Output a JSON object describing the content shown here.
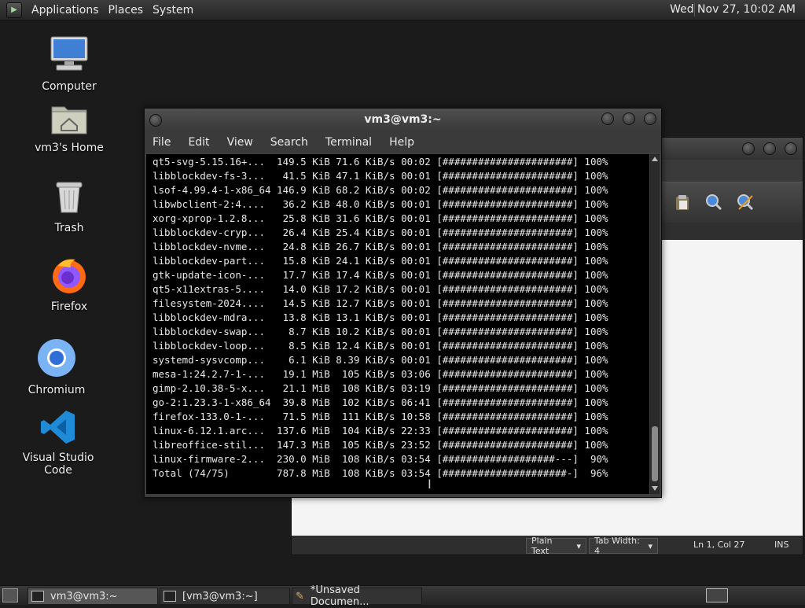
{
  "top_panel": {
    "menus": [
      "Applications",
      "Places",
      "System"
    ],
    "clock": "Wed Nov 27, 10:02 AM"
  },
  "desktop_icons": [
    {
      "label": "Computer",
      "icon": "computer-icon"
    },
    {
      "label": "vm3's Home",
      "icon": "home-folder-icon"
    },
    {
      "label": "Trash",
      "icon": "trash-icon"
    },
    {
      "label": "Firefox",
      "icon": "firefox-icon"
    },
    {
      "label": "Chromium",
      "icon": "chromium-icon"
    },
    {
      "label": "Visual Studio Code",
      "icon": "vscode-icon"
    }
  ],
  "terminal": {
    "title": "vm3@vm3:~",
    "menus": [
      "File",
      "Edit",
      "View",
      "Search",
      "Terminal",
      "Help"
    ],
    "lines": [
      {
        "name": "qt5-svg-5.15.16+...",
        "size": "149.5 KiB",
        "rate": "71.6 KiB/s",
        "time": "00:02",
        "bar": "[######################]",
        "pct": "100%"
      },
      {
        "name": "libblockdev-fs-3...",
        "size": "41.5 KiB",
        "rate": "47.1 KiB/s",
        "time": "00:01",
        "bar": "[######################]",
        "pct": "100%"
      },
      {
        "name": "lsof-4.99.4-1-x86_64",
        "size": "146.9 KiB",
        "rate": "68.2 KiB/s",
        "time": "00:02",
        "bar": "[######################]",
        "pct": "100%"
      },
      {
        "name": "libwbclient-2:4....",
        "size": "36.2 KiB",
        "rate": "48.0 KiB/s",
        "time": "00:01",
        "bar": "[######################]",
        "pct": "100%"
      },
      {
        "name": "xorg-xprop-1.2.8...",
        "size": "25.8 KiB",
        "rate": "31.6 KiB/s",
        "time": "00:01",
        "bar": "[######################]",
        "pct": "100%"
      },
      {
        "name": "libblockdev-cryp...",
        "size": "26.4 KiB",
        "rate": "25.4 KiB/s",
        "time": "00:01",
        "bar": "[######################]",
        "pct": "100%"
      },
      {
        "name": "libblockdev-nvme...",
        "size": "24.8 KiB",
        "rate": "26.7 KiB/s",
        "time": "00:01",
        "bar": "[######################]",
        "pct": "100%"
      },
      {
        "name": "libblockdev-part...",
        "size": "15.8 KiB",
        "rate": "24.1 KiB/s",
        "time": "00:01",
        "bar": "[######################]",
        "pct": "100%"
      },
      {
        "name": "gtk-update-icon-...",
        "size": "17.7 KiB",
        "rate": "17.4 KiB/s",
        "time": "00:01",
        "bar": "[######################]",
        "pct": "100%"
      },
      {
        "name": "qt5-x11extras-5....",
        "size": "14.0 KiB",
        "rate": "17.2 KiB/s",
        "time": "00:01",
        "bar": "[######################]",
        "pct": "100%"
      },
      {
        "name": "filesystem-2024....",
        "size": "14.5 KiB",
        "rate": "12.7 KiB/s",
        "time": "00:01",
        "bar": "[######################]",
        "pct": "100%"
      },
      {
        "name": "libblockdev-mdra...",
        "size": "13.8 KiB",
        "rate": "13.1 KiB/s",
        "time": "00:01",
        "bar": "[######################]",
        "pct": "100%"
      },
      {
        "name": "libblockdev-swap...",
        "size": "8.7 KiB",
        "rate": "10.2 KiB/s",
        "time": "00:01",
        "bar": "[######################]",
        "pct": "100%"
      },
      {
        "name": "libblockdev-loop...",
        "size": "8.5 KiB",
        "rate": "12.4 KiB/s",
        "time": "00:01",
        "bar": "[######################]",
        "pct": "100%"
      },
      {
        "name": "systemd-sysvcomp...",
        "size": "6.1 KiB",
        "rate": "8.39 KiB/s",
        "time": "00:01",
        "bar": "[######################]",
        "pct": "100%"
      },
      {
        "name": "mesa-1:24.2.7-1-...",
        "size": "19.1 MiB",
        "rate": "105 KiB/s",
        "time": "03:06",
        "bar": "[######################]",
        "pct": "100%"
      },
      {
        "name": "gimp-2.10.38-5-x...",
        "size": "21.1 MiB",
        "rate": "108 KiB/s",
        "time": "03:19",
        "bar": "[######################]",
        "pct": "100%"
      },
      {
        "name": "go-2:1.23.3-1-x86_64",
        "size": "39.8 MiB",
        "rate": "102 KiB/s",
        "time": "06:41",
        "bar": "[######################]",
        "pct": "100%"
      },
      {
        "name": "firefox-133.0-1-...",
        "size": "71.5 MiB",
        "rate": "111 KiB/s",
        "time": "10:58",
        "bar": "[######################]",
        "pct": "100%"
      },
      {
        "name": "linux-6.12.1.arc...",
        "size": "137.6 MiB",
        "rate": "104 KiB/s",
        "time": "22:33",
        "bar": "[######################]",
        "pct": "100%"
      },
      {
        "name": "libreoffice-stil...",
        "size": "147.3 MiB",
        "rate": "105 KiB/s",
        "time": "23:52",
        "bar": "[######################]",
        "pct": "100%"
      },
      {
        "name": "linux-firmware-2...",
        "size": "230.0 MiB",
        "rate": "108 KiB/s",
        "time": "03:54",
        "bar": "[###################---]",
        "pct": "90%"
      },
      {
        "name": "Total (74/75)",
        "size": "787.8 MiB",
        "rate": "108 KiB/s",
        "time": "03:54",
        "bar": "[#####################-]",
        "pct": "96%"
      }
    ]
  },
  "gedit": {
    "statusbar": {
      "language": "Plain Text",
      "tab_width": "Tab Width:  4",
      "position": "Ln 1, Col 27",
      "mode": "INS"
    }
  },
  "taskbar": {
    "tasks": [
      {
        "label": "vm3@vm3:~",
        "active": true
      },
      {
        "label": "[vm3@vm3:~]",
        "active": false
      },
      {
        "label": "*Unsaved Documen...",
        "active": false
      }
    ]
  },
  "colors": {
    "desktop_bg": "#1b1b1b",
    "terminal_bg": "#000000",
    "terminal_fg": "#e8e8e8",
    "panel_bg": "#2f2f2f"
  }
}
